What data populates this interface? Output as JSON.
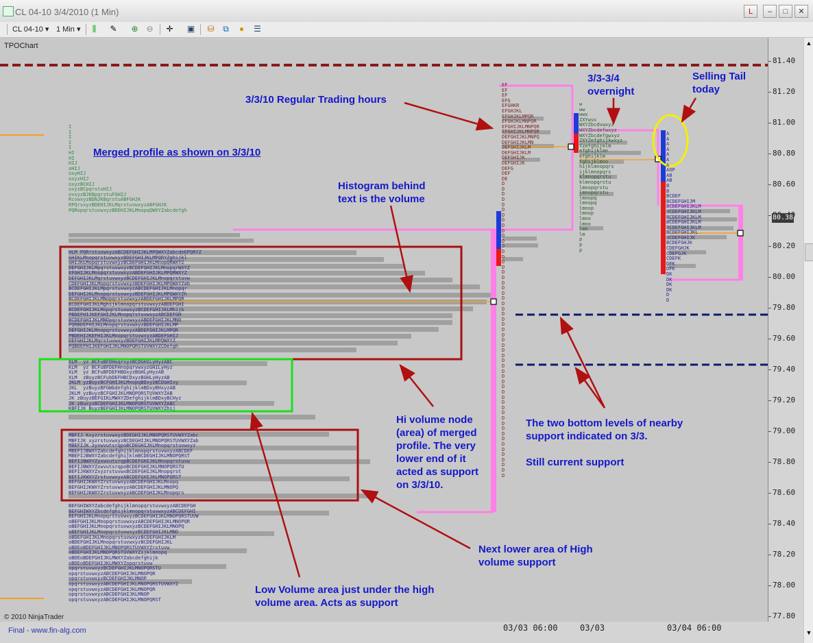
{
  "window": {
    "title": "CL 04-10   3/4/2010 (1 Min)",
    "buttons": {
      "link": "L",
      "minimize": "–",
      "maximize": "□",
      "close": "✕"
    }
  },
  "toolbar": {
    "instrument": "CL 04-10",
    "interval": "1 Min",
    "icons": [
      "bar-style-icon",
      "draw-pencil-icon",
      "zoom-in-icon",
      "zoom-out-icon",
      "crosshair-icon",
      "snapshot-icon",
      "indicators-icon",
      "strategies-icon",
      "currency-icon",
      "properties-icon"
    ]
  },
  "chart": {
    "panel_label": "TPOChart",
    "copyright": "© 2010 NinjaTrader",
    "footer_link": "Final - www.fin-alg.com",
    "y_axis": [
      "81.40",
      "81.20",
      "81.00",
      "80.80",
      "80.60",
      "80.40",
      "80.20",
      "80.00",
      "79.80",
      "79.60",
      "79.40",
      "79.20",
      "79.00",
      "78.80",
      "78.60",
      "78.40",
      "78.20",
      "78.00",
      "77.80"
    ],
    "x_axis": [
      "03/03 06:00",
      "03/03",
      "03/04 06:00"
    ],
    "current_price": "80.38"
  },
  "annotations": {
    "merged_title": "Merged profile as shown on 3/3/10",
    "rth": "3/3/10 Regular Trading hours",
    "overnight": [
      "3/3-3/4",
      "overnight"
    ],
    "selling_tail": [
      "Selling Tail",
      "today"
    ],
    "histogram": [
      "Histogram behind",
      "text is the volume"
    ],
    "hi_volume": [
      "Hi volume node",
      "(area) of merged",
      "profile.  The very",
      "lower end of it",
      "acted as support",
      "on 3/3/10."
    ],
    "support_levels": [
      "The two bottom levels of nearby",
      "support indicated on 3/3."
    ],
    "still_support": "Still current support",
    "next_lower": [
      "Next lower area of High",
      "volume support"
    ],
    "low_volume": [
      "Low Volume area just under the high",
      "volume area.  Acts as support"
    ]
  },
  "colors": {
    "chart_bg": "#c8c8c8",
    "annotation_text": "#1418c8",
    "resistance_line": "#8b1a1a",
    "support_line": "#0d1a6b",
    "box_red": "#a81010",
    "box_green": "#1adf1a",
    "profile_outline": "#ff7fe8",
    "highlight_circle": "#f5f000",
    "arrow": "#b01010"
  }
}
